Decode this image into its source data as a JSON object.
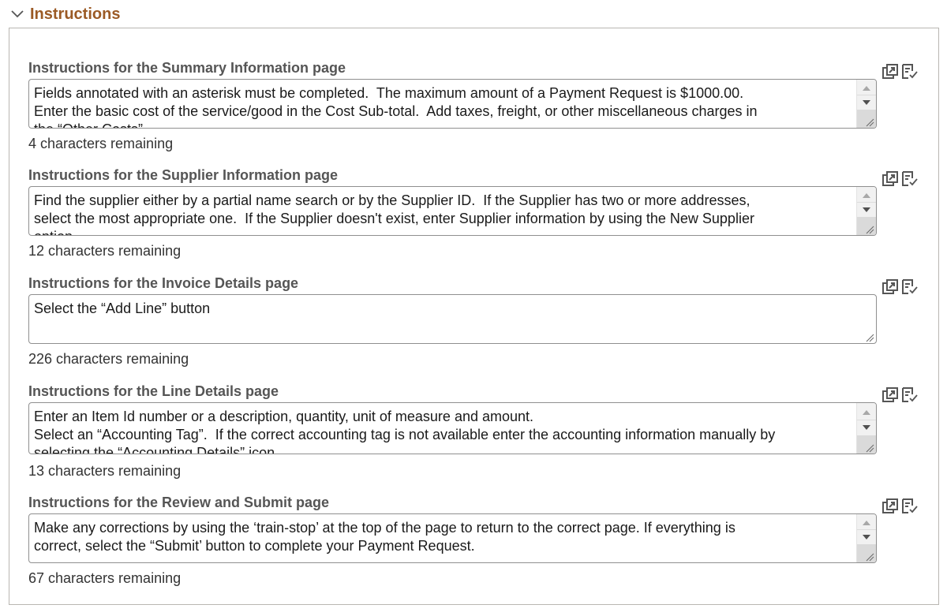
{
  "section": {
    "title": "Instructions",
    "collapse_icon": "chevron-down-icon",
    "expanded": true
  },
  "fields": [
    {
      "label": "Instructions for the Summary Information page",
      "value": "Fields annotated with an asterisk must be completed.  The maximum amount of a Payment Request is $1000.00.\nEnter the basic cost of the service/good in the Cost Sub-total.  Add taxes, freight, or other miscellaneous charges in\nthe “Other Costs”.",
      "counter": "4 characters remaining",
      "has_scrollbar": true
    },
    {
      "label": "Instructions for the Supplier Information page",
      "value": "Find the supplier either by a partial name search or by the Supplier ID.  If the Supplier has two or more addresses,\nselect the most appropriate one.  If the Supplier doesn't exist, enter Supplier information by using the New Supplier\noption.",
      "counter": "12 characters remaining",
      "has_scrollbar": true
    },
    {
      "label": "Instructions for the Invoice Details page",
      "value": "Select the “Add Line” button",
      "counter": "226 characters remaining",
      "has_scrollbar": false
    },
    {
      "label": "Instructions for the Line Details page",
      "value": "Enter an Item Id number or a description, quantity, unit of measure and amount.\nSelect an “Accounting Tag”.  If the correct accounting tag is not available enter the accounting information manually by\nselecting the “Accounting Details” icon.",
      "counter": "13 characters remaining",
      "has_scrollbar": true
    },
    {
      "label": "Instructions for the Review and Submit page",
      "value": "Make any corrections by using the ‘train-stop’ at the top of the page to return to the correct page. If everything is\ncorrect, select the “Submit’ button to complete your Payment Request.",
      "counter": "67 characters remaining",
      "has_scrollbar": true
    }
  ],
  "icons": {
    "expand": "expand-window-icon",
    "spellcheck": "spell-check-icon"
  },
  "colors": {
    "section_title": "#9b5a25",
    "label": "#555555",
    "panel_border": "#b9b6b1",
    "icon": "#555555"
  }
}
